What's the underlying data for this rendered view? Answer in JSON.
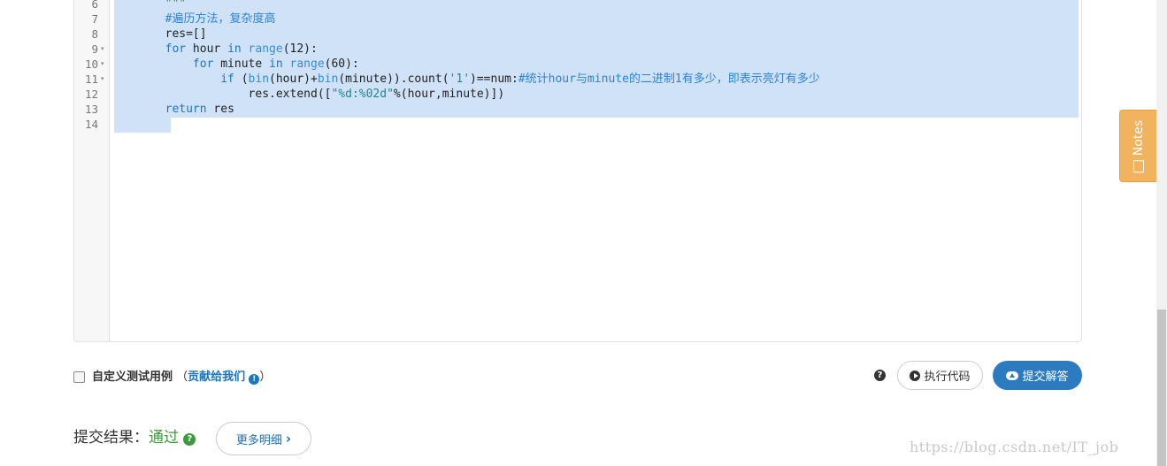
{
  "editor": {
    "line_numbers": [
      "6",
      "7",
      "8",
      "9",
      "10",
      "11",
      "12",
      "13",
      "14"
    ],
    "code": {
      "line6": "\"\"\"",
      "line7_comment": "#遍历方法，复杂度高",
      "line8": "res=[]",
      "line9_kw": "for",
      "line9_var": " hour ",
      "line9_in": "in",
      "line9_fn": " range",
      "line9_rest": "(12):",
      "line10_kw": "for",
      "line10_var": " minute ",
      "line10_in": "in",
      "line10_fn": " range",
      "line10_rest": "(60):",
      "line11_kw": "if",
      "line11_p1": " (",
      "line11_bin1": "bin",
      "line11_p2": "(hour)+",
      "line11_bin2": "bin",
      "line11_p3": "(minute)).count(",
      "line11_str": "'1'",
      "line11_p4": ")==num:",
      "line11_comment": "#统计hour与minute的二进制1有多少，即表示亮灯有多少",
      "line12_a": "res.extend([",
      "line12_str": "\"%d:%02d\"",
      "line12_b": "%(hour,minute)])",
      "line13_kw": "return",
      "line13_rest": " res"
    },
    "fold_marker": "▾"
  },
  "notes_tab": {
    "label": "Notes",
    "icon": "note-icon",
    "color": "#f2b35f"
  },
  "controls": {
    "custom_test_label": "自定义测试用例",
    "paren_open": "（",
    "contribute_link": "贡献给我们",
    "paren_close": "）",
    "help_glyph": "?",
    "run_button": "执行代码",
    "submit_button": "提交解答",
    "info_glyph": "!"
  },
  "result": {
    "label": "提交结果：",
    "status": "通过",
    "status_glyph": "?",
    "more_button": "更多明细",
    "chevron": "›"
  },
  "watermark": "https://blog.csdn.net/IT_job",
  "colors": {
    "accent": "#2c7ac0",
    "selection": "#cfe2f8",
    "pass": "#3c9a3c"
  }
}
